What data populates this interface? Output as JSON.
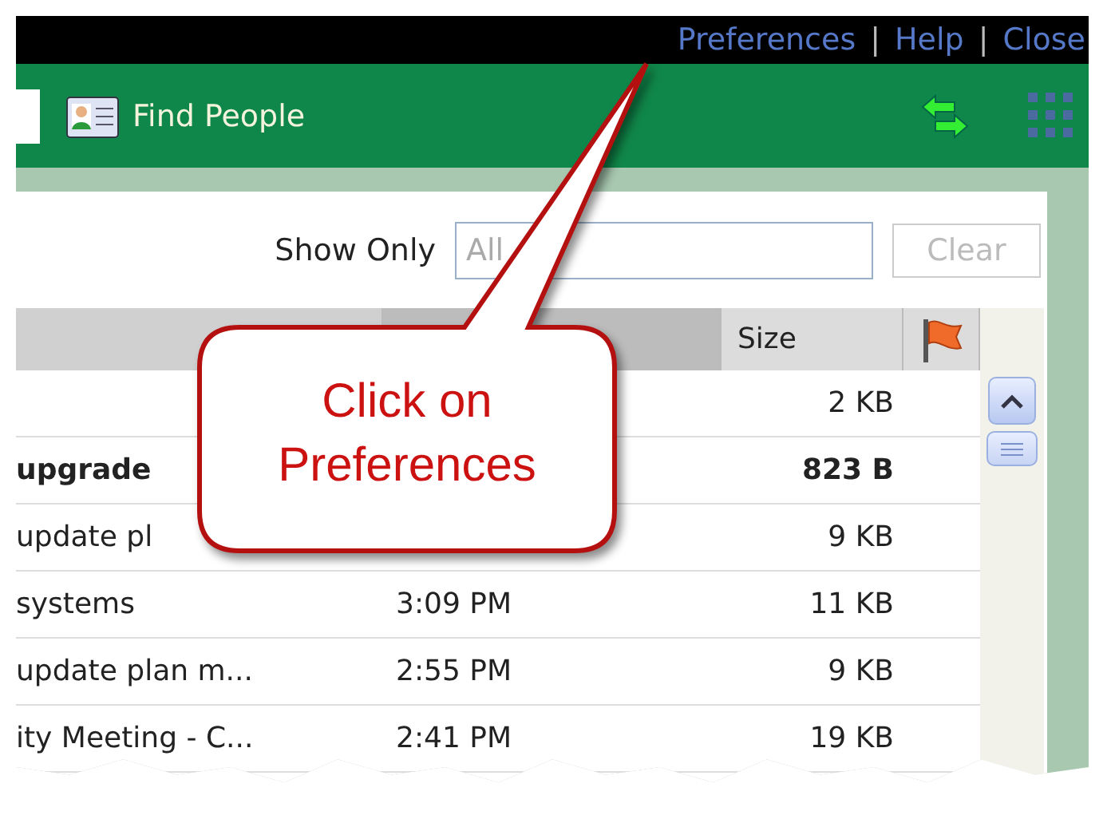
{
  "top_links": [
    {
      "kind": "link",
      "label": "Preferences"
    },
    {
      "kind": "separator",
      "label": "|"
    },
    {
      "kind": "link",
      "label": "Help"
    },
    {
      "kind": "separator",
      "label": "|"
    },
    {
      "kind": "link",
      "label": "Close"
    }
  ],
  "toolbar": {
    "find_people": "Find People"
  },
  "filter": {
    "label": "Show Only",
    "placeholder": "All",
    "clear": "Clear",
    "clear_disabled": true
  },
  "table": {
    "columns": [
      {
        "kind": "blank"
      },
      {
        "kind": "blank"
      },
      {
        "kind": "text",
        "label": "Size"
      },
      {
        "kind": "flag"
      }
    ],
    "rows": [
      {
        "size": "2 KB",
        "unread": false
      },
      {
        "name": "upgrade",
        "size": "823 B",
        "unread": true
      },
      {
        "name": "update pl",
        "size": "9 KB",
        "unread": false
      },
      {
        "name": "systems",
        "time": "3:09 PM",
        "size": "11 KB",
        "unread": false
      },
      {
        "name": "update plan m...",
        "time": "2:55 PM",
        "size": "9 KB",
        "unread": false
      },
      {
        "name": "ity Meeting - C...",
        "time": "2:41 PM",
        "size": "19 KB",
        "unread": false
      }
    ]
  },
  "callout": {
    "text": "Click on Preferences"
  }
}
